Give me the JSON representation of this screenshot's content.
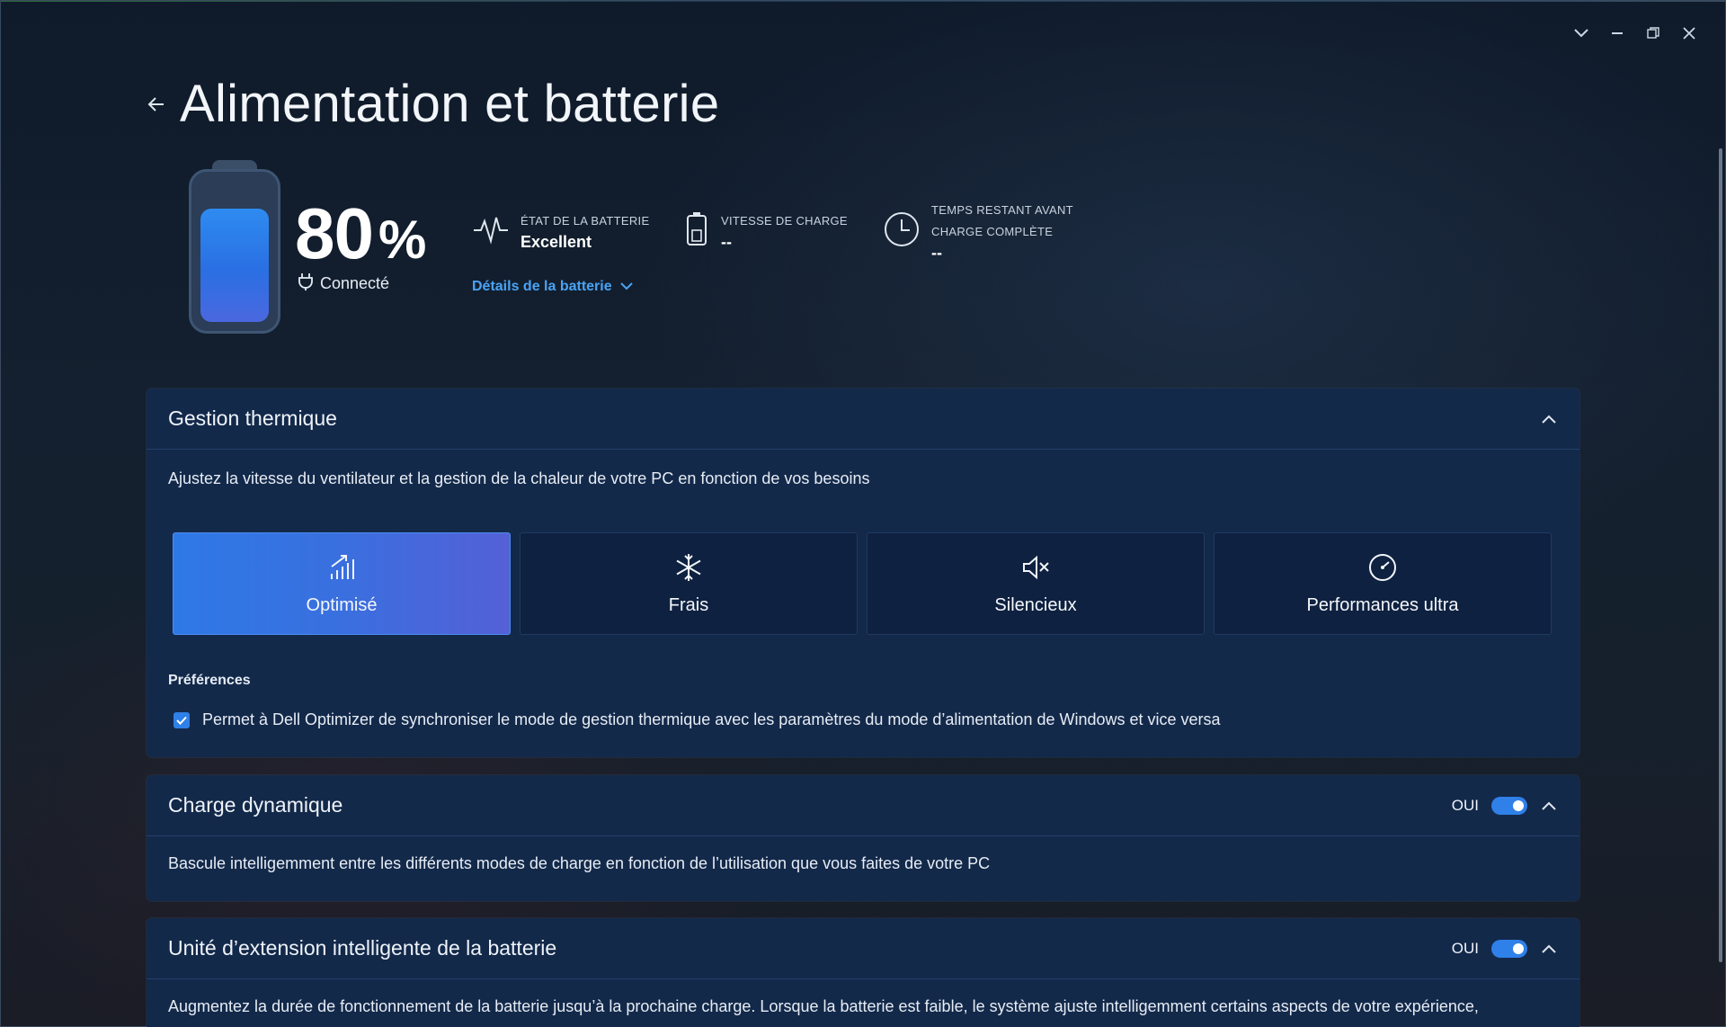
{
  "window": {
    "controls": {
      "dropdown": "⌄",
      "minimize": "—",
      "restore": "❐",
      "close": "✕"
    }
  },
  "header": {
    "title": "Alimentation et batterie",
    "back_icon": "back-arrow-icon"
  },
  "battery": {
    "level_percent": 80,
    "percent_number": "80",
    "percent_unit": "%",
    "connection_status": "Connecté",
    "fill_color": "#2a6fe3"
  },
  "stats": {
    "health": {
      "label": "ÉTAT DE LA BATTERIE",
      "value": "Excellent",
      "icon": "heartbeat-icon"
    },
    "charge_speed": {
      "label": "VITESSE DE CHARGE",
      "value": "--",
      "icon": "battery-small-icon"
    },
    "time_remaining": {
      "label_line1": "TEMPS RESTANT AVANT",
      "label_line2": "CHARGE COMPLÈTE",
      "value": "--",
      "icon": "clock-icon"
    },
    "details_link": "Détails de la batterie"
  },
  "thermal": {
    "title": "Gestion thermique",
    "description": "Ajustez la vitesse du ventilateur et la gestion de la chaleur de votre PC en fonction de vos besoins",
    "modes": [
      {
        "label": "Optimisé",
        "icon": "optimized-signal-icon",
        "selected": true
      },
      {
        "label": "Frais",
        "icon": "snowflake-icon",
        "selected": false
      },
      {
        "label": "Silencieux",
        "icon": "speaker-mute-icon",
        "selected": false
      },
      {
        "label": "Performances ultra",
        "icon": "speedometer-icon",
        "selected": false
      }
    ],
    "preferences_title": "Préférences",
    "preference_text": "Permet à Dell Optimizer de synchroniser le mode de gestion thermique avec les paramètres du mode d’alimentation de Windows et vice versa",
    "preference_checked": true
  },
  "dynamic_charge": {
    "title": "Charge dynamique",
    "toggle_label": "OUI",
    "toggle_on": true,
    "description": "Bascule intelligemment entre les différents modes de charge en fonction de l’utilisation que vous faites de votre PC"
  },
  "battery_extender": {
    "title": "Unité d’extension intelligente de la batterie",
    "toggle_label": "OUI",
    "toggle_on": true,
    "description": "Augmentez la durée de fonctionnement de la batterie jusqu’à la prochaine charge. Lorsque la batterie est faible, le système ajuste intelligemment certains aspects de votre expérience,"
  },
  "colors": {
    "accent": "#2f80e8",
    "panel": "#13294a",
    "link": "#4aa3f5"
  }
}
